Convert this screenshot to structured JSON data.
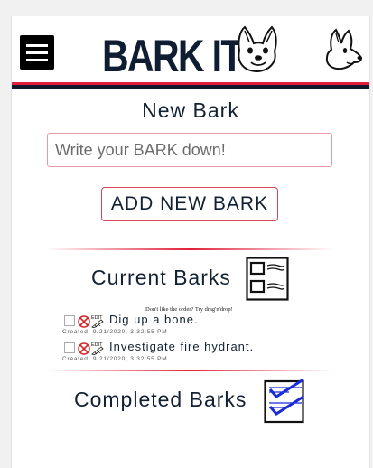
{
  "header": {
    "logo_text": "BARK IT",
    "menu_icon": "hamburger-menu-icon",
    "accent_red": "#e0203a",
    "navy": "#141a2e"
  },
  "new_bark": {
    "title": "New Bark",
    "input_placeholder": "Write your BARK down!",
    "input_value": "",
    "add_button_label": "ADD NEW BARK"
  },
  "current": {
    "title": "Current Barks",
    "icon": "list-icon",
    "tip": "Don't like the order? Try drag'n'drop!",
    "items": [
      {
        "text": "Dig up a bone.",
        "created": "Created: 9/21/2020, 3:32:55 PM",
        "checked": false,
        "edit_label": "EDIT"
      },
      {
        "text": "Investigate fire hydrant.",
        "created": "Created: 9/21/2020, 3:32:55 PM",
        "checked": false,
        "edit_label": "EDIT"
      }
    ]
  },
  "completed": {
    "title": "Completed Barks",
    "icon": "checklist-icon",
    "items": []
  }
}
